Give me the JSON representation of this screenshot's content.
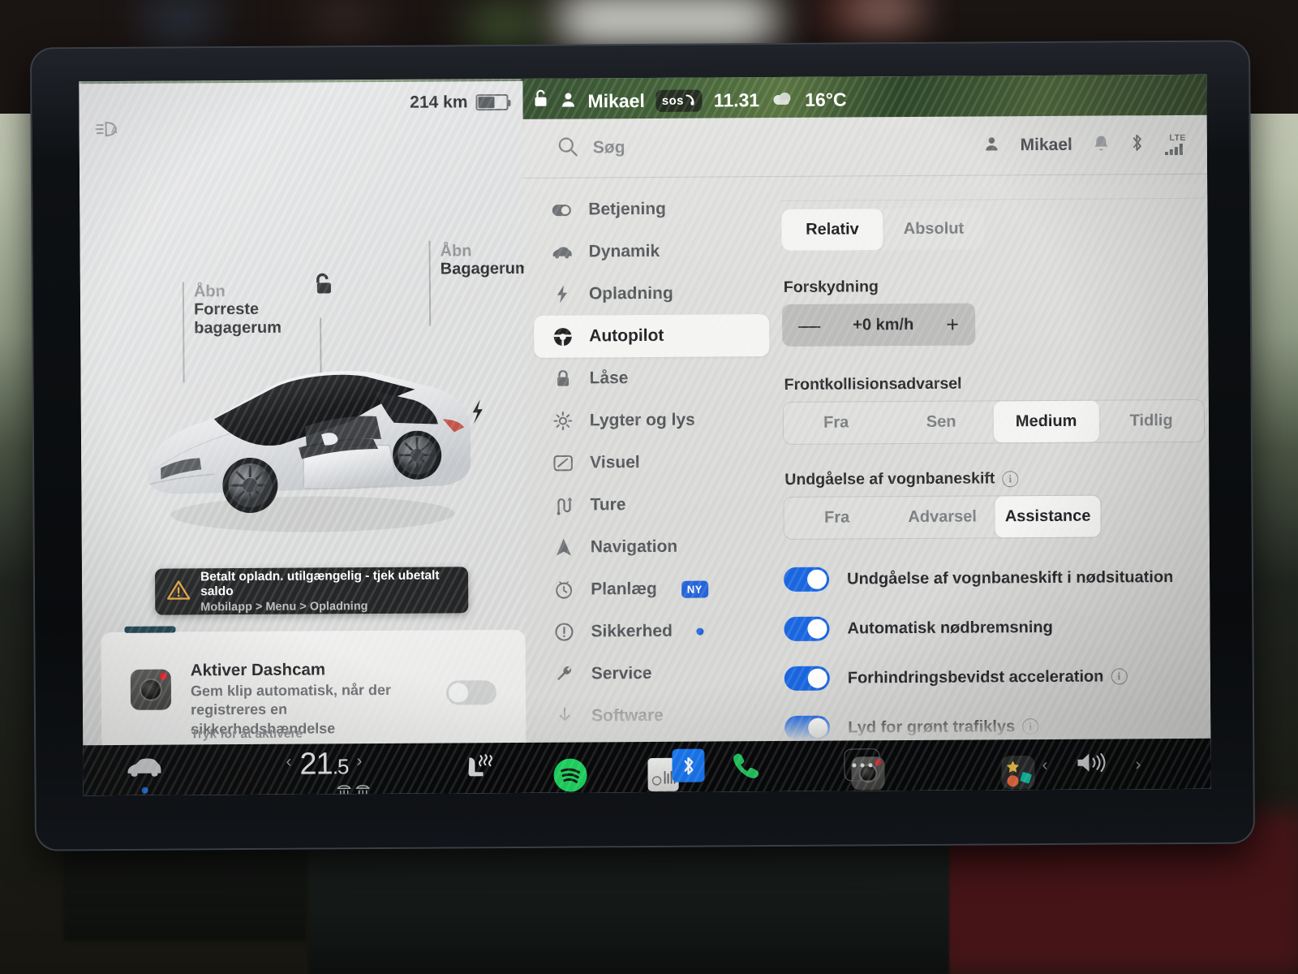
{
  "status_strip": {
    "lock_icon": "unlocked-padlock-icon",
    "profile_icon": "person-icon",
    "profile_name": "Mikael",
    "sos_label": "sos",
    "time": "11.31",
    "weather_icon": "cloud-icon",
    "temperature": "16°C"
  },
  "vehicle_card": {
    "range": "214 km",
    "battery_icon": "battery-icon",
    "autolight_icon": "auto-highbeam-icon",
    "lock_icon": "unlocked-padlock-icon",
    "callouts": [
      {
        "action": "Åbn",
        "target_line1": "Forreste",
        "target_line2": "bagagerum"
      },
      {
        "action": "Åbn",
        "target_line1": "Bagagerum",
        "target_line2": ""
      }
    ],
    "car_image": "tesla-model-3-white",
    "alert": {
      "icon": "warning-triangle-icon",
      "title": "Betalt opladn. utilgængelig - tjek ubetalt saldo",
      "path": "Mobilapp > Menu > Opladning"
    },
    "dashcam": {
      "icon": "dashcam-icon",
      "title": "Aktiver Dashcam",
      "description": "Gem klip automatisk, når der registreres en sikkerhedshændelse",
      "hint": "Tryk for at aktivere",
      "toggle_on": false
    }
  },
  "settings_panel": {
    "search": {
      "icon": "search-icon",
      "placeholder": "Søg"
    },
    "status_icons": {
      "profile_icon": "person-icon",
      "profile_name": "Mikael",
      "bell_icon": "bell-icon",
      "bluetooth_icon": "bluetooth-icon",
      "signal_label": "LTE",
      "signal_icon": "signal-bars-icon"
    },
    "nav_items": [
      {
        "icon": "toggle-icon",
        "label": "Betjening",
        "active": false,
        "badge": "",
        "dot": false
      },
      {
        "icon": "car-icon",
        "label": "Dynamik",
        "active": false,
        "badge": "",
        "dot": false
      },
      {
        "icon": "bolt-icon",
        "label": "Opladning",
        "active": false,
        "badge": "",
        "dot": false
      },
      {
        "icon": "steering-wheel-icon",
        "label": "Autopilot",
        "active": true,
        "badge": "",
        "dot": false
      },
      {
        "icon": "lock-icon",
        "label": "Låse",
        "active": false,
        "badge": "",
        "dot": false
      },
      {
        "icon": "sun-icon",
        "label": "Lygter og lys",
        "active": false,
        "badge": "",
        "dot": false
      },
      {
        "icon": "display-icon",
        "label": "Visuel",
        "active": false,
        "badge": "",
        "dot": false
      },
      {
        "icon": "route-icon",
        "label": "Ture",
        "active": false,
        "badge": "",
        "dot": false
      },
      {
        "icon": "navigation-arrow-icon",
        "label": "Navigation",
        "active": false,
        "badge": "",
        "dot": false
      },
      {
        "icon": "clock-icon",
        "label": "Planlæg",
        "active": false,
        "badge": "NY",
        "dot": false
      },
      {
        "icon": "alert-circle-icon",
        "label": "Sikkerhed",
        "active": false,
        "badge": "",
        "dot": true
      },
      {
        "icon": "wrench-icon",
        "label": "Service",
        "active": false,
        "badge": "",
        "dot": false
      },
      {
        "icon": "download-icon",
        "label": "Software",
        "active": false,
        "badge": "",
        "dot": false
      }
    ],
    "speed_mode": {
      "options": [
        "Relativ",
        "Absolut"
      ],
      "selected": "Relativ"
    },
    "offset": {
      "label": "Forskydning",
      "minus": "—",
      "value": "+0 km/h",
      "plus": "+"
    },
    "forward_collision": {
      "label": "Frontkollisionsadvarsel",
      "options": [
        "Fra",
        "Sen",
        "Medium",
        "Tidlig"
      ],
      "selected": "Medium"
    },
    "lane_departure": {
      "label": "Undgåelse af vognbaneskift",
      "info_icon": "info-icon",
      "options": [
        "Fra",
        "Advarsel",
        "Assistance"
      ],
      "selected": "Assistance"
    },
    "toggles": [
      {
        "label": "Undgåelse af vognbaneskift i nødsituation",
        "on": true,
        "info": false
      },
      {
        "label": "Automatisk nødbremsning",
        "on": true,
        "info": false
      },
      {
        "label": "Forhindringsbevidst acceleration",
        "on": true,
        "info": true
      },
      {
        "label": "Lyd for grønt trafiklys",
        "on": true,
        "info": true
      }
    ]
  },
  "dock": {
    "car_icon": "car-icon",
    "temp_prev": "‹",
    "temperature": "21.5",
    "temp_next": "›",
    "defroster_icons": "defroster-icon",
    "seat_heater_icon": "seat-heater-icon",
    "apps": [
      {
        "icon": "spotify-icon",
        "label": "Spotify"
      },
      {
        "icon": "radio-icon",
        "label": "Radio"
      },
      {
        "icon": "bluetooth-icon",
        "label": "Bluetooth"
      },
      {
        "icon": "phone-icon",
        "label": "Telefon"
      },
      {
        "icon": "dashcam-icon",
        "label": "Dashcam"
      },
      {
        "icon": "more-icon",
        "label": "Mere"
      },
      {
        "icon": "toybox-icon",
        "label": "Toybox"
      }
    ],
    "volume_prev": "‹",
    "volume_icon": "speaker-icon",
    "volume_next": "›"
  },
  "colors": {
    "accent_blue": "#1a66e0",
    "badge_blue": "#2563d9",
    "spotify_green": "#1ed760",
    "bluetooth_blue": "#1877f2",
    "warning_amber": "#e8a33d",
    "rec_red": "#e8212c"
  }
}
